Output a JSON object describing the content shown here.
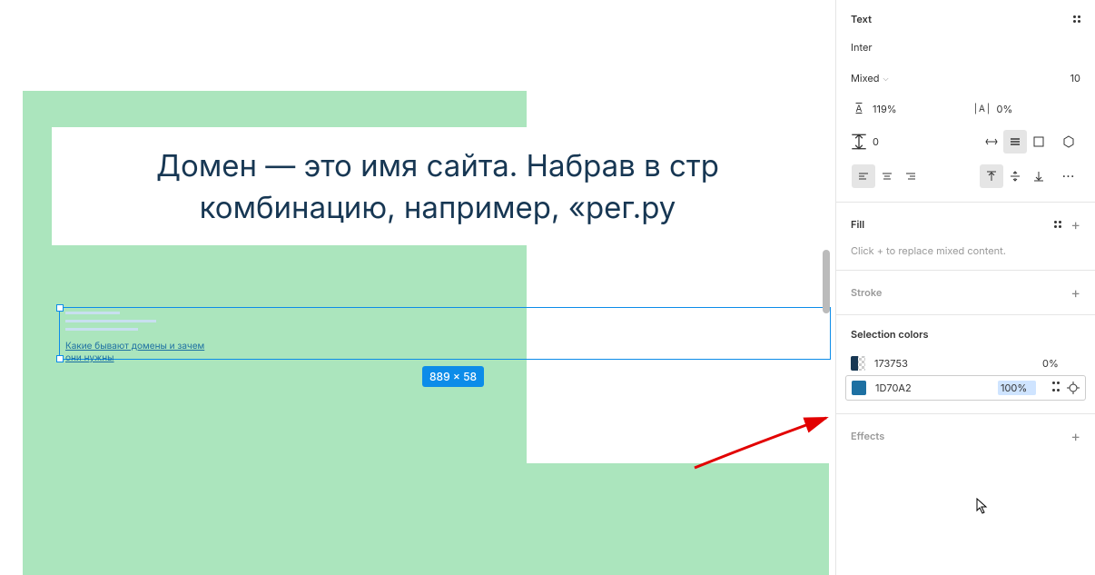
{
  "canvas": {
    "heading_line1": "Домен — это имя сайта. Набрав в стр",
    "heading_line2": "комбинацию, например, «рег.ру",
    "link_text": "Какие бывают домены и зачем они нужны",
    "selection_size": "889 × 58"
  },
  "panel": {
    "text": {
      "title": "Text",
      "font": "Inter",
      "weight": "Mixed",
      "size": "10",
      "line_height": "119%",
      "letter_spacing": "0%",
      "paragraph_spacing": "0"
    },
    "fill": {
      "title": "Fill",
      "hint": "Click + to replace mixed content."
    },
    "stroke": {
      "title": "Stroke"
    },
    "selection_colors": {
      "title": "Selection colors",
      "items": [
        {
          "hex": "173753",
          "pct": "0%",
          "swatch": "#173753",
          "split": true
        },
        {
          "hex": "1D70A2",
          "pct": "100%",
          "swatch": "#1d70a2",
          "split": false,
          "active": true
        }
      ]
    },
    "effects": {
      "title": "Effects"
    }
  }
}
